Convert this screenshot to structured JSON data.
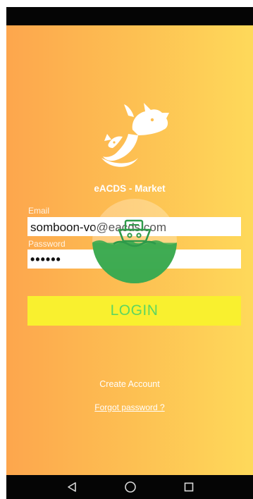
{
  "app": {
    "title": "eACDS - Market",
    "logo_icon": "dog-cat-logo-icon",
    "gradient": [
      "#fda64d",
      "#fed95a"
    ]
  },
  "login_form": {
    "email_label": "Email",
    "email_value": "somboon-vo@eacds.com",
    "password_label": "Password",
    "password_value": "••••••",
    "login_label": "LOGIN",
    "login_button_color": "#f9f02f",
    "login_text_color": "#5fd65f"
  },
  "links": {
    "create_account": "Create Account",
    "forgot_password": "Forgot password ?"
  },
  "loading_overlay": {
    "icon": "boat-on-water-icon"
  },
  "nav_bar": {
    "back_icon": "back-triangle-icon",
    "home_icon": "home-circle-icon",
    "recents_icon": "recents-square-icon"
  }
}
